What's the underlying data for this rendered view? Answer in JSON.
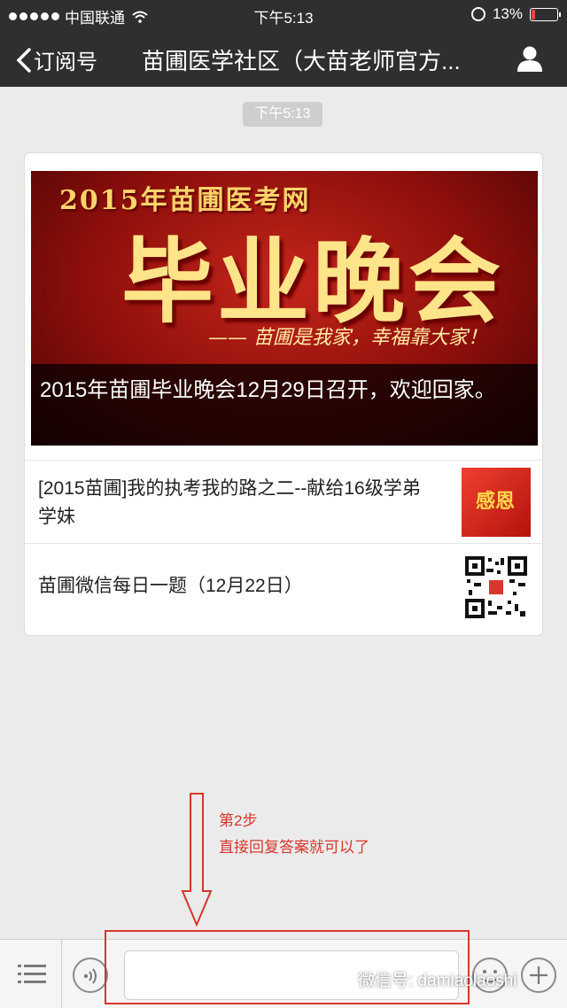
{
  "status_bar": {
    "carrier": "中国联通",
    "time": "下午5:13",
    "battery": "13%",
    "battery_level": 0.13,
    "battery_color": "#e8473d"
  },
  "nav": {
    "back_label": "订阅号",
    "title": "苗圃医学社区（大苗老师官方...",
    "profile_icon": "person-icon"
  },
  "chat": {
    "timestamp": "下午5:13",
    "card": {
      "cover": {
        "image_subtitle": "2015年苗圃医考网",
        "image_heading": "毕业晚会",
        "image_slogan": "—— 苗圃是我家，幸福靠大家！",
        "caption": "2015年苗圃毕业晚会12月29日召开，欢迎回家。"
      },
      "items": [
        {
          "title": "[2015苗圃]我的执考我的路之二--献给16级学弟学妹",
          "thumb_text": "感恩"
        },
        {
          "title": "苗圃微信每日一题（12月22日）",
          "thumb_icon": "qr-code-icon"
        }
      ]
    }
  },
  "annotation": {
    "step": "第2步",
    "instruction": "直接回复答案就可以了",
    "color": "#d6372c"
  },
  "toolbar": {
    "menu_icon": "list-menu-icon",
    "voice_icon": "voice-icon",
    "input_value": "",
    "emoji_icon": "emoji-icon",
    "plus_icon": "plus-icon"
  },
  "watermark": "微信号: damiaolaoshi"
}
